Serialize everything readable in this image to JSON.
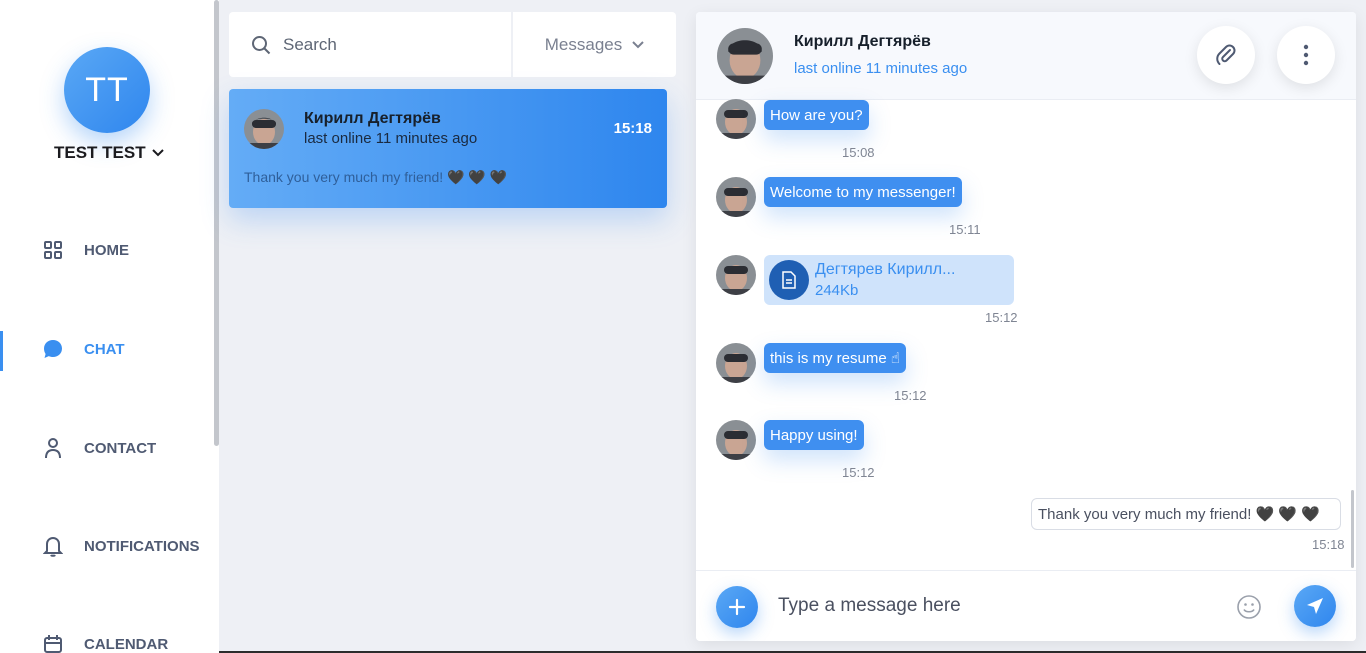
{
  "user": {
    "initials": "TT",
    "name": "TEST TEST"
  },
  "nav": [
    {
      "label": "HOME",
      "icon": "grid-icon"
    },
    {
      "label": "CHAT",
      "icon": "chat-bubble-icon",
      "active": true
    },
    {
      "label": "CONTACT",
      "icon": "person-icon"
    },
    {
      "label": "NOTIFICATIONS",
      "icon": "bell-icon"
    },
    {
      "label": "CALENDAR",
      "icon": "calendar-icon"
    }
  ],
  "search": {
    "placeholder": "Search",
    "filter": "Messages"
  },
  "conversations": [
    {
      "name": "Кирилл Дегтярёв",
      "status": "last online 11 minutes ago",
      "time": "15:18",
      "preview": "Thank you very much my friend! 🖤 🖤 🖤"
    }
  ],
  "chat": {
    "name": "Кирилл Дегтярёв",
    "status": "last online 11 minutes ago",
    "messages": [
      {
        "type": "text",
        "text": "How are you?",
        "time": "15:08"
      },
      {
        "type": "text",
        "text": "Welcome to my messenger!",
        "time": "15:11"
      },
      {
        "type": "file",
        "name": "Дегтярев Кирилл...",
        "size": "244Kb",
        "time": "15:12"
      },
      {
        "type": "text",
        "text": "this is my resume ☝",
        "time": "15:12"
      },
      {
        "type": "text",
        "text": "Happy using!",
        "time": "15:12"
      },
      {
        "type": "own",
        "text": "Thank you very much my friend! 🖤 🖤 🖤",
        "time": "15:18"
      }
    ],
    "composer_placeholder": "Type a message here"
  },
  "colors": {
    "accent": "#3a8ff0",
    "sidebar_text": "#4f5a72"
  }
}
